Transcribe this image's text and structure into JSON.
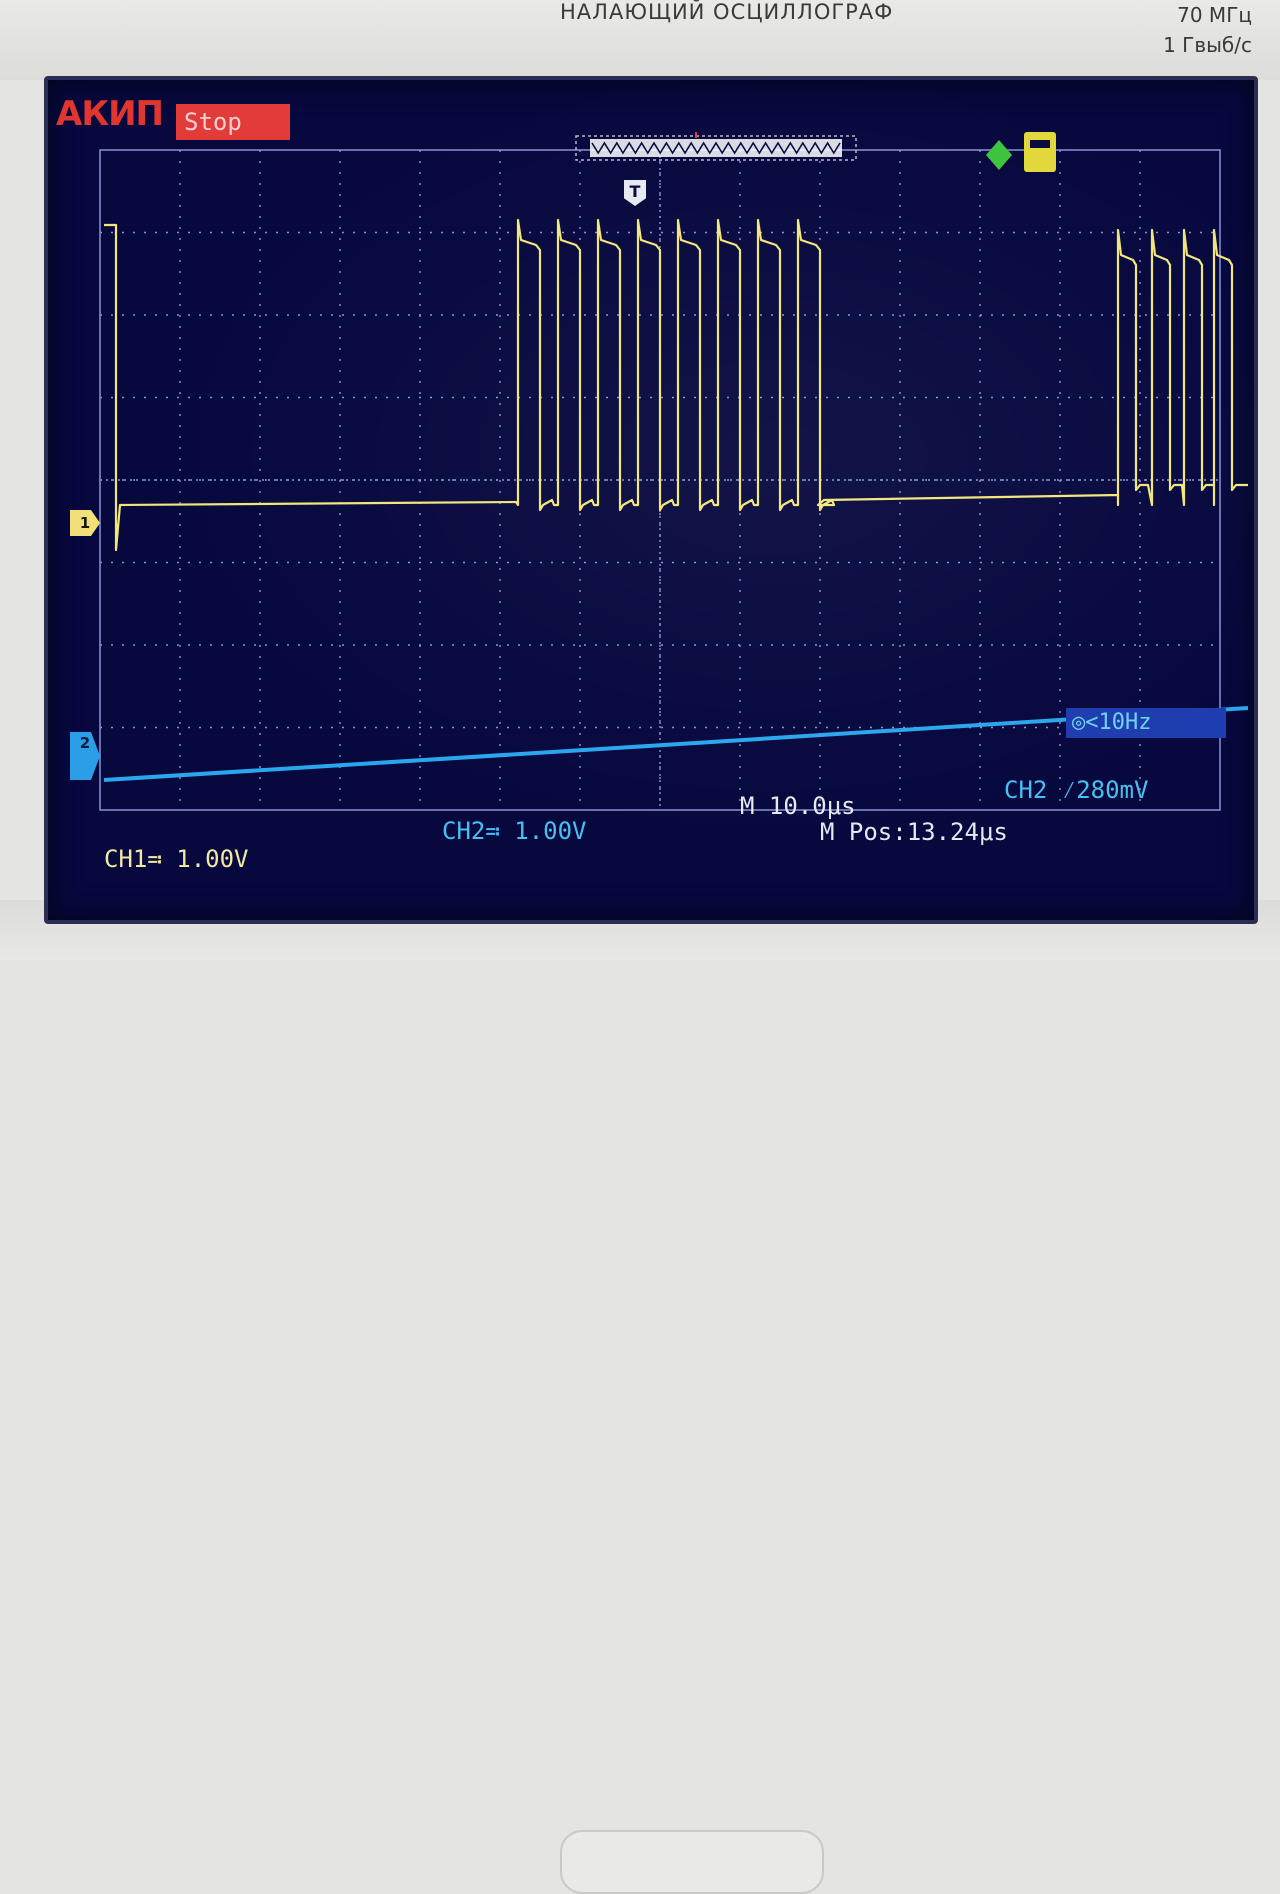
{
  "device": {
    "model_label": "НАЛАЮЩИЙ ОСЦИЛЛОГРАФ",
    "bandwidth": "70 МГц",
    "sample_rate": "1 Гвыб/с"
  },
  "screen": {
    "brand": "АКИП",
    "run_status": "Stop",
    "trigger_marker": "T",
    "ch1_marker": "1",
    "ch2_marker": "2",
    "freq_readout": "◎<10Hz",
    "ch1_scale": "CH1≕ 1.00V",
    "ch2_scale": "CH2≕ 1.00V",
    "timebase": "M 10.0μs",
    "h_position": "M Pos:13.24μs",
    "trigger_level": "CH2 ⁄280mV",
    "colors": {
      "ch1": "#f2e67a",
      "ch2": "#2aa6ee",
      "grid": "#8a93d8",
      "background": "#06083e",
      "status_red": "#e33a3a"
    },
    "icons": [
      "trigger-icon",
      "usb-icon",
      "printer-icon"
    ]
  }
}
